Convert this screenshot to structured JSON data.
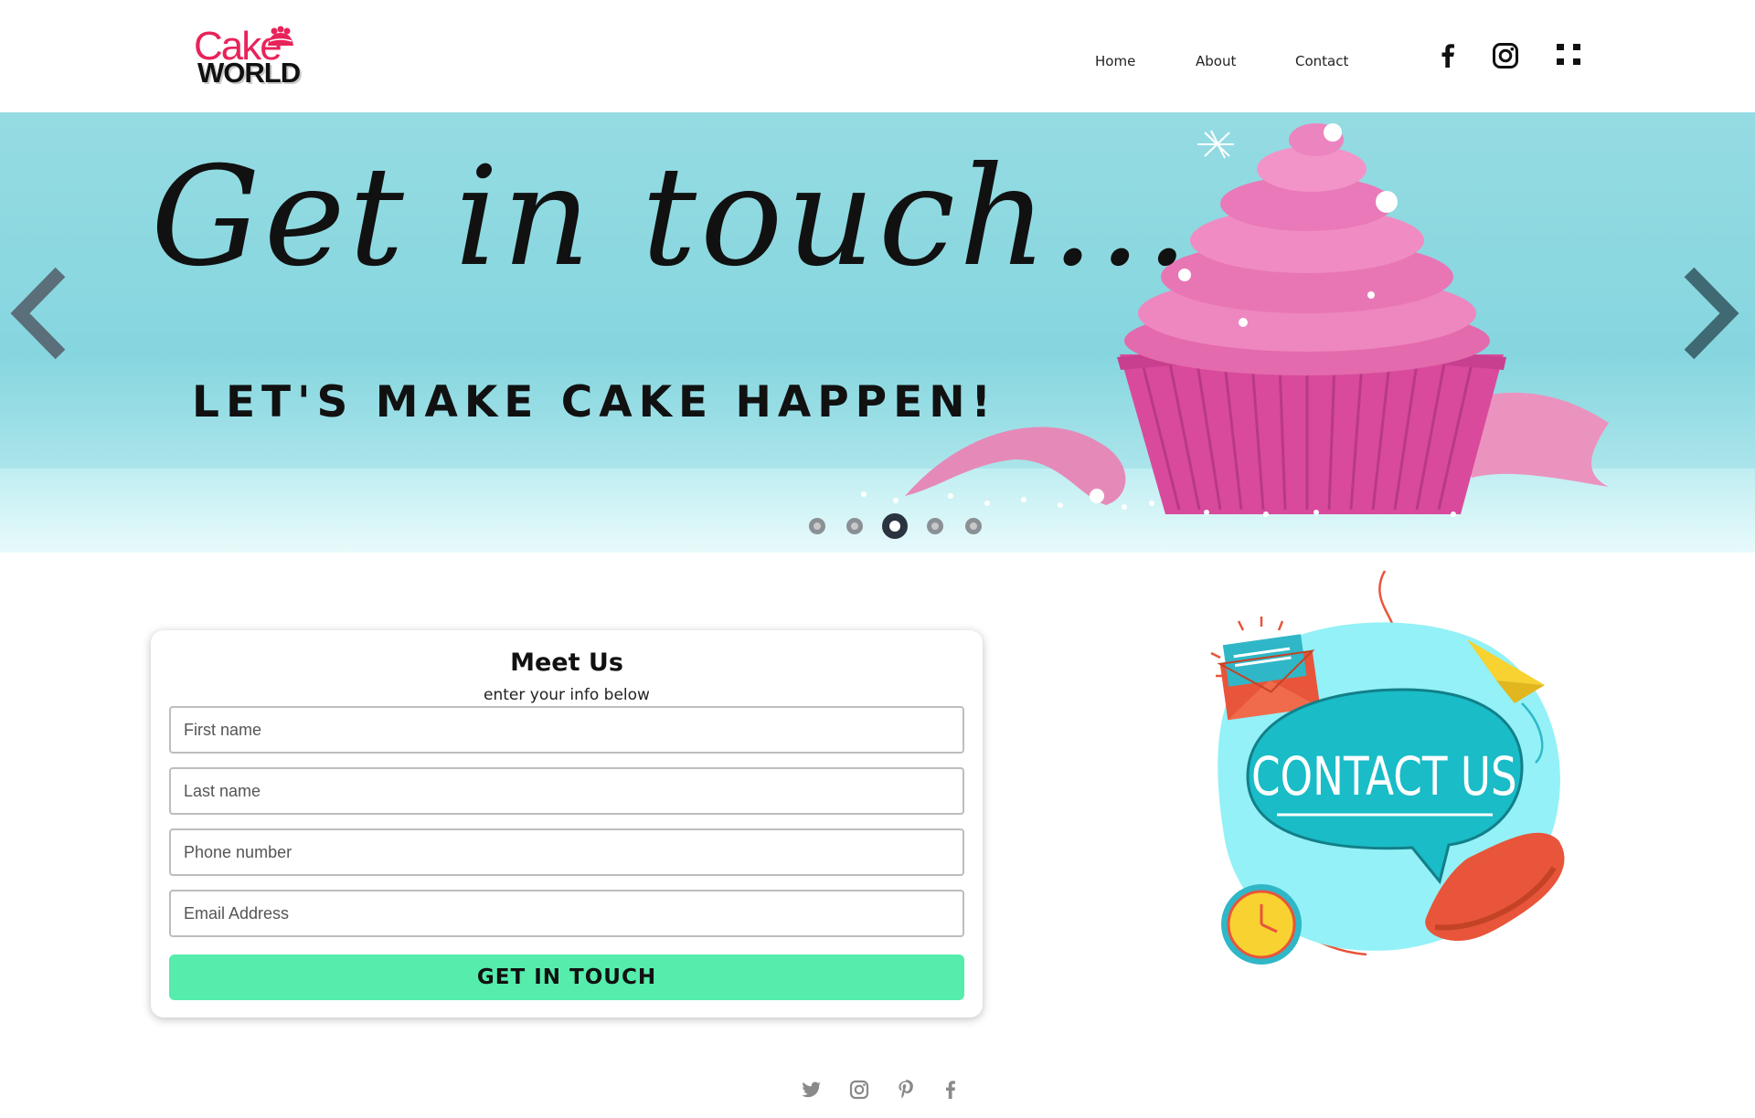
{
  "logo": {
    "line1": "Cake",
    "line2": "WORLD",
    "brand_color": "#e8235a"
  },
  "nav": {
    "home": "Home",
    "about": "About",
    "contact": "Contact"
  },
  "header_social": [
    "facebook-icon",
    "instagram-icon",
    "menu-grid-icon"
  ],
  "hero": {
    "headline": "Get in touch...",
    "subheadline": "LET'S MAKE CAKE HAPPEN!",
    "slides": 5,
    "active_slide": 3,
    "bg_color": "#8ed8e0"
  },
  "form": {
    "title": "Meet Us",
    "subtitle": "enter your info below",
    "fields": {
      "first_name": {
        "placeholder": "First name",
        "value": ""
      },
      "last_name": {
        "placeholder": "Last name",
        "value": ""
      },
      "phone": {
        "placeholder": "Phone number",
        "value": ""
      },
      "email": {
        "placeholder": "Email Address",
        "value": ""
      }
    },
    "submit_label": "GET IN TOUCH",
    "submit_color": "#55ecac"
  },
  "illustration": {
    "text": "CONTACT US"
  },
  "footer_social": [
    "twitter-icon",
    "instagram-icon",
    "pinterest-icon",
    "facebook-icon"
  ]
}
